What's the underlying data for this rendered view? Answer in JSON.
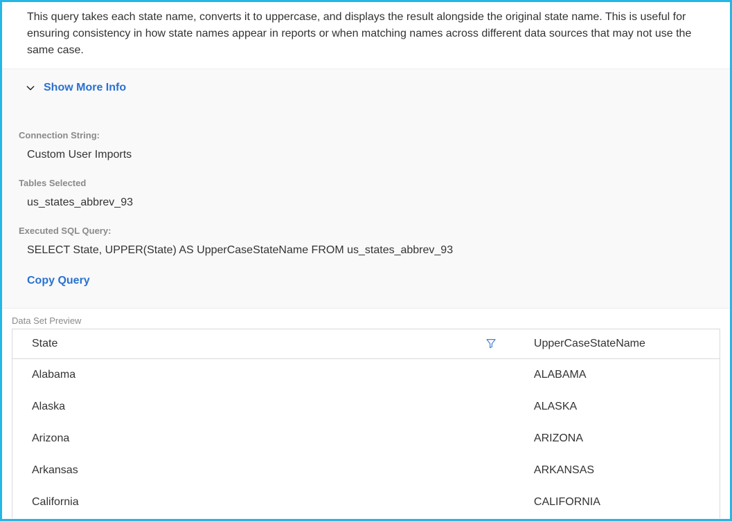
{
  "description": "This query takes each state name, converts it to uppercase, and displays the result alongside the original state name. This is useful for ensuring consistency in how state names appear in reports or when matching names across different data sources that may not use the same case.",
  "info": {
    "show_more_label": "Show More Info",
    "connection_label": "Connection String:",
    "connection_value": "Custom User Imports",
    "tables_label": "Tables Selected",
    "tables_value": "us_states_abbrev_93",
    "sql_label": "Executed SQL Query:",
    "sql_value": "SELECT State, UPPER(State) AS UpperCaseStateName FROM us_states_abbrev_93",
    "copy_query_label": "Copy Query"
  },
  "preview": {
    "section_label": "Data Set Preview",
    "columns": [
      "State",
      "UpperCaseStateName"
    ],
    "rows": [
      {
        "State": "Alabama",
        "UpperCaseStateName": "ALABAMA"
      },
      {
        "State": "Alaska",
        "UpperCaseStateName": "ALASKA"
      },
      {
        "State": "Arizona",
        "UpperCaseStateName": "ARIZONA"
      },
      {
        "State": "Arkansas",
        "UpperCaseStateName": "ARKANSAS"
      },
      {
        "State": "California",
        "UpperCaseStateName": "CALIFORNIA"
      }
    ]
  },
  "icons": {
    "chevron": "chevron-down-icon",
    "filter": "filter-icon"
  },
  "colors": {
    "frame_border": "#26b6e6",
    "link": "#2a71d0",
    "muted": "#8a8a8a",
    "panel_bg": "#f9f9fa",
    "border": "#d9d9d9"
  }
}
